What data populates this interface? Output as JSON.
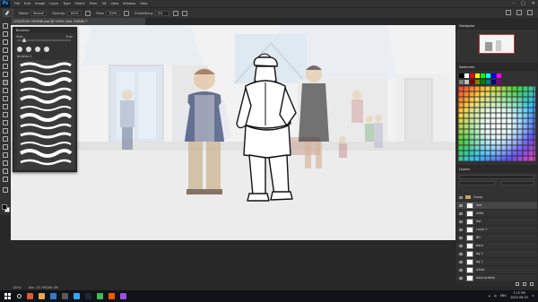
{
  "menubar": {
    "app_icon": "Ps",
    "items": [
      "File",
      "Edit",
      "Image",
      "Layer",
      "Type",
      "Select",
      "Filter",
      "3D",
      "View",
      "Window",
      "Help"
    ],
    "window_icons": [
      "minimize-icon",
      "maximize-icon",
      "close-icon"
    ]
  },
  "options": {
    "mode_label": "Mode:",
    "mode_value": "Normal",
    "opacity_label": "Opacity:",
    "opacity_value": "100%",
    "flow_label": "Flow:",
    "flow_value": "100%",
    "smoothing_label": "Smoothing:",
    "smoothing_value": "0%"
  },
  "document": {
    "tab_title": "LOCATION: DEVINE.psd @ 100% (line, RGB/8) *"
  },
  "brushes_panel": {
    "title": "Brushes",
    "size_label": "Size:",
    "size_value": "6 px",
    "group_label": "brushes 1"
  },
  "navigator": {
    "title": "Navigator"
  },
  "swatches": {
    "title": "Swatches",
    "colors": [
      "#000000",
      "#ffffff",
      "#ff0000",
      "#ffff00",
      "#00ff00",
      "#00ffff",
      "#0000ff",
      "#ff00ff",
      "#7f7f7f",
      "#c0c0c0",
      "#7f0000",
      "#7f7f00",
      "#007f00",
      "#007f7f",
      "#00007f",
      "#7f007f"
    ]
  },
  "layers": {
    "title": "Layers",
    "items": [
      {
        "name": "Group",
        "type": "folder"
      },
      {
        "name": "line",
        "type": "layer"
      },
      {
        "name": "hilite",
        "type": "layer"
      },
      {
        "name": "flat",
        "type": "layer"
      },
      {
        "name": "Layer 1",
        "type": "layer"
      },
      {
        "name": "BG",
        "type": "layer"
      },
      {
        "name": "back",
        "type": "layer"
      },
      {
        "name": "bg 2",
        "type": "layer"
      },
      {
        "name": "bg 1",
        "type": "layer"
      },
      {
        "name": "white",
        "type": "layer"
      },
      {
        "name": "base bubble",
        "type": "layer"
      }
    ]
  },
  "status": {
    "zoom": "100%",
    "doc_size": "Doc: 23.7M/284.4M"
  },
  "taskbar": {
    "apps": [
      "#e05a2b",
      "#e9a64a",
      "#2e7bd1",
      "#5a5a5a",
      "#31a8ff",
      "#1b2838",
      "#3dbb5f",
      "#ff5500",
      "#9c4fe0"
    ],
    "tray_lang": "ENG",
    "time": "7:13 PM",
    "date": "2020-06-03"
  }
}
